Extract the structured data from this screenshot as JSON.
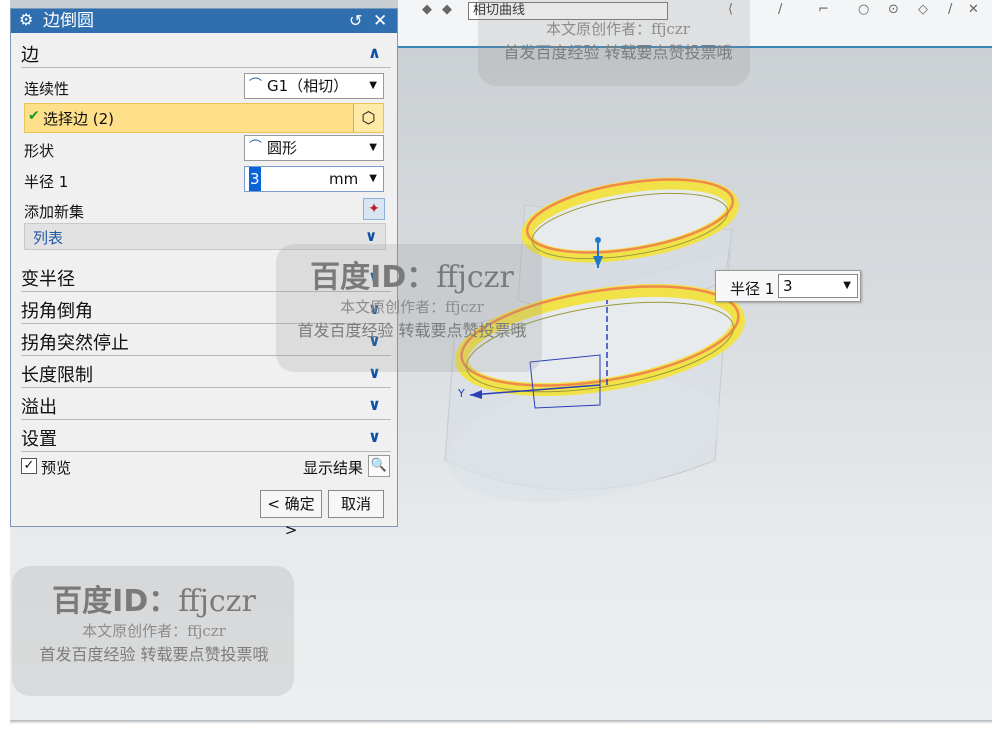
{
  "dialog": {
    "title": "边倒圆",
    "groups": {
      "edge": {
        "label": "边",
        "continuity_label": "连续性",
        "continuity_value": "G1（相切）",
        "select_edge_label": "选择边 (2)",
        "shape_label": "形状",
        "shape_value": "圆形",
        "radius_label": "半径 1",
        "radius_value": "3",
        "radius_unit": "mm",
        "add_set_label": "添加新集",
        "list_label": "列表"
      },
      "collapsed": [
        {
          "label": "变半径"
        },
        {
          "label": "拐角倒角"
        },
        {
          "label": "拐角突然停止"
        },
        {
          "label": "长度限制"
        },
        {
          "label": "溢出"
        },
        {
          "label": "设置"
        }
      ]
    },
    "preview_label": "预览",
    "preview_checked": true,
    "show_result_label": "显示结果",
    "ok_label": "< 确定 >",
    "cancel_label": "取消"
  },
  "toolbar": {
    "selection_filter_value": "相切曲线"
  },
  "viewport_callout": {
    "label": "半径 1",
    "value": "3"
  },
  "axis_label": "Y",
  "watermark": {
    "id_line_bold": "百度ID：",
    "id_line_name": "ffjczr",
    "author_line": "本文原创作者：ffjczr",
    "notice_line": "首发百度经验  转载要点赞投票哦"
  },
  "colors": {
    "title_bar": "#2f6fb0",
    "selected_row": "#ffe08a",
    "fillet_highlight": "#f2e24a",
    "edge_outline": "#f08a4a",
    "accent": "#0a4fa8"
  }
}
